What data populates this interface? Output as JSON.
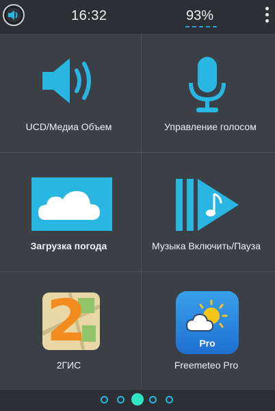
{
  "status_bar": {
    "time": "16:32",
    "battery": "93%"
  },
  "tiles": [
    {
      "label": "UCD/Медиа Объем",
      "icon": "speaker-icon"
    },
    {
      "label": "Управление голосом",
      "icon": "microphone-icon"
    },
    {
      "label": "Загрузка погода",
      "icon": "cloud-icon"
    },
    {
      "label": "Музыка Включить/Пауза",
      "icon": "music-play-icon"
    },
    {
      "label": "2ГИС",
      "icon": "2gis-app-icon"
    },
    {
      "label": "Freemeteo Pro",
      "icon": "freemeteo-pro-icon"
    }
  ],
  "freemeteo_badge": "Pro",
  "gis_number": "2",
  "pager": {
    "pages": 5,
    "active_index": 2
  },
  "colors": {
    "accent": "#29b6e3",
    "active_dot": "#2ee6c3",
    "background": "#3b4047",
    "bar": "#2c3035"
  }
}
